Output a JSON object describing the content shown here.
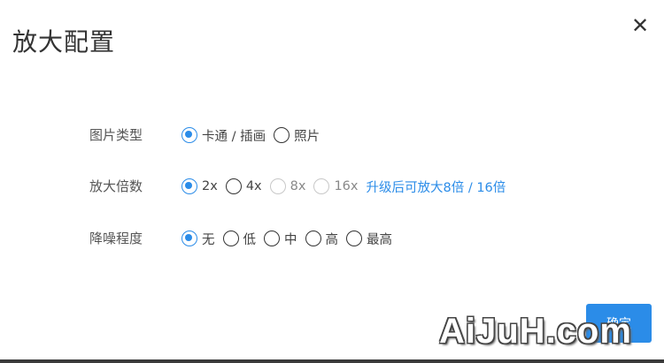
{
  "dialog": {
    "title": "放大配置",
    "close_icon": "close-icon",
    "close_glyph": "✕"
  },
  "image_type": {
    "label": "图片类型",
    "options": [
      {
        "label": "卡通 / 插画",
        "selected": true,
        "disabled": false
      },
      {
        "label": "照片",
        "selected": false,
        "disabled": false
      }
    ]
  },
  "scale": {
    "label": "放大倍数",
    "options": [
      {
        "label": "2x",
        "selected": true,
        "disabled": false
      },
      {
        "label": "4x",
        "selected": false,
        "disabled": false
      },
      {
        "label": "8x",
        "selected": false,
        "disabled": true
      },
      {
        "label": "16x",
        "selected": false,
        "disabled": true
      }
    ],
    "upgrade_link": "升级后可放大8倍 / 16倍"
  },
  "denoise": {
    "label": "降噪程度",
    "options": [
      {
        "label": "无",
        "selected": true,
        "disabled": false
      },
      {
        "label": "低",
        "selected": false,
        "disabled": false
      },
      {
        "label": "中",
        "selected": false,
        "disabled": false
      },
      {
        "label": "高",
        "selected": false,
        "disabled": false
      },
      {
        "label": "最高",
        "selected": false,
        "disabled": false
      }
    ]
  },
  "confirm_button": "确定",
  "watermark": "AiJuH.com",
  "colors": {
    "accent": "#2b8ce8",
    "text": "#444444",
    "disabled": "#c8c8c8"
  }
}
